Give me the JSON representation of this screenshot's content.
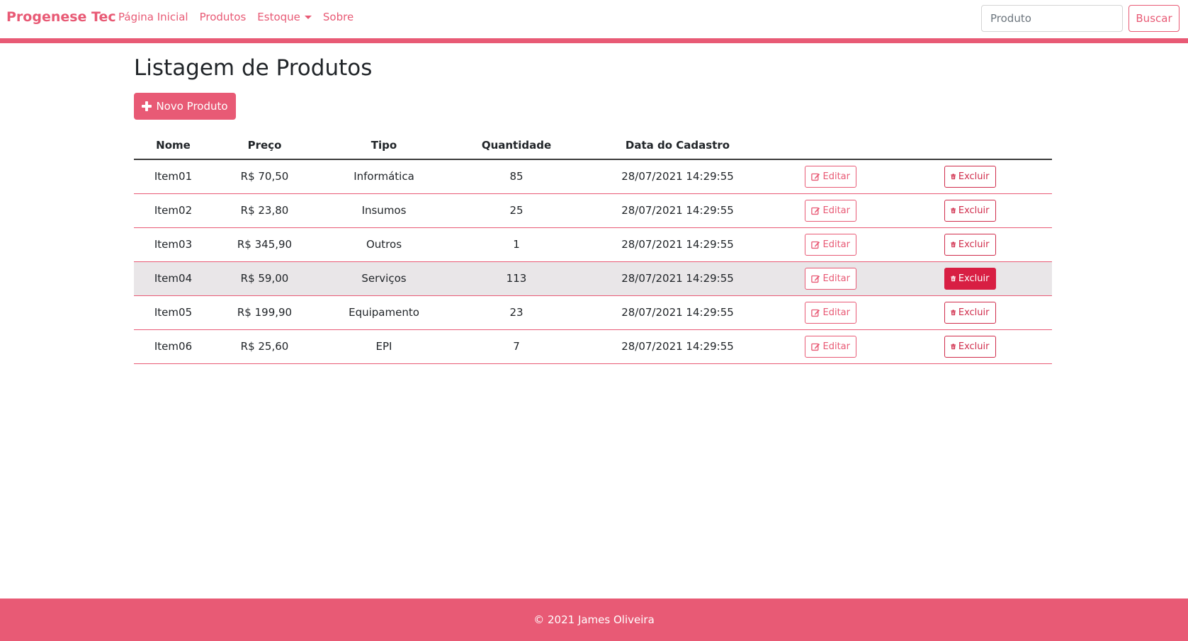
{
  "navbar": {
    "brand": "Progenese Tec",
    "links": [
      "Página Inicial",
      "Produtos",
      "Estoque",
      "Sobre"
    ],
    "search_placeholder": "Produto",
    "search_button": "Buscar"
  },
  "main": {
    "title": "Listagem de Produtos",
    "new_button": "Novo Produto",
    "table": {
      "headers": [
        "Nome",
        "Preço",
        "Tipo",
        "Quantidade",
        "Data do Cadastro"
      ],
      "rows": [
        [
          "Item01",
          "R$ 70,50",
          "Informática",
          "85",
          "28/07/2021 14:29:55"
        ],
        [
          "Item02",
          "R$ 23,80",
          "Insumos",
          "25",
          "28/07/2021 14:29:55"
        ],
        [
          "Item03",
          "R$ 345,90",
          "Outros",
          "1",
          "28/07/2021 14:29:55"
        ],
        [
          "Item04",
          "R$ 59,00",
          "Serviços",
          "113",
          "28/07/2021 14:29:55"
        ],
        [
          "Item05",
          "R$ 199,90",
          "Equipamento",
          "23",
          "28/07/2021 14:29:55"
        ],
        [
          "Item06",
          "R$ 25,60",
          "EPI",
          "7",
          "28/07/2021 14:29:55"
        ]
      ],
      "edit_label": "Editar",
      "delete_label": "Excluir",
      "highlighted_row": 3
    }
  },
  "footer": {
    "text": "© 2021 James Oliveira"
  },
  "colors": {
    "accent": "#e85a75",
    "danger": "#d81f43",
    "row_highlight": "#e9e6e8"
  }
}
